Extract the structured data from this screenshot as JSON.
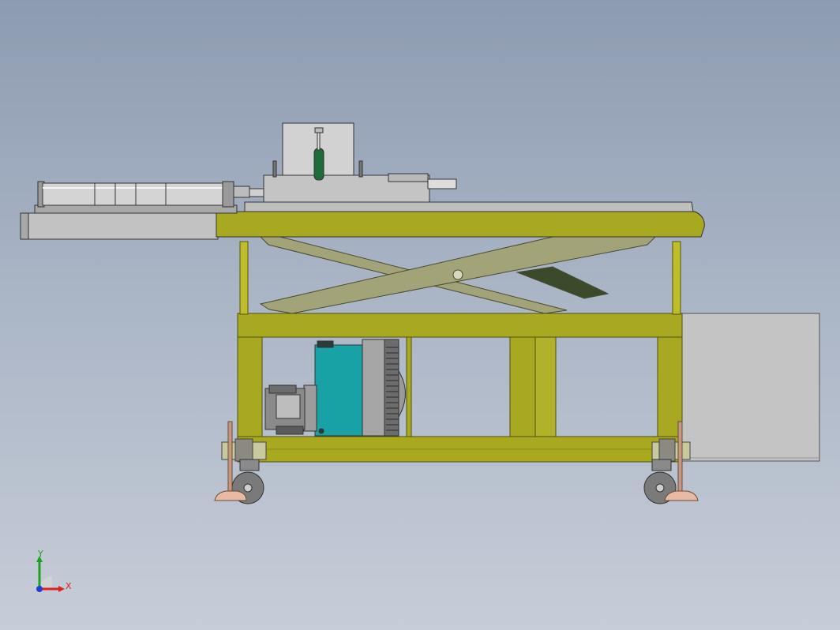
{
  "scene": {
    "colors": {
      "frame": "#a9a821",
      "frame_dark": "#86851a",
      "steel": "#b7b7b7",
      "steel_dark": "#8f8f8f",
      "tank": "#18a2a6",
      "scissor": "#a3a37a",
      "foot_pad": "#e6b8a2",
      "cabinet": "#c3c3c3"
    }
  },
  "triad": {
    "x_label": "X",
    "y_label": "Y",
    "x_color": "#e02020",
    "y_color": "#1fa21f",
    "z_color": "#1f3fd0"
  }
}
